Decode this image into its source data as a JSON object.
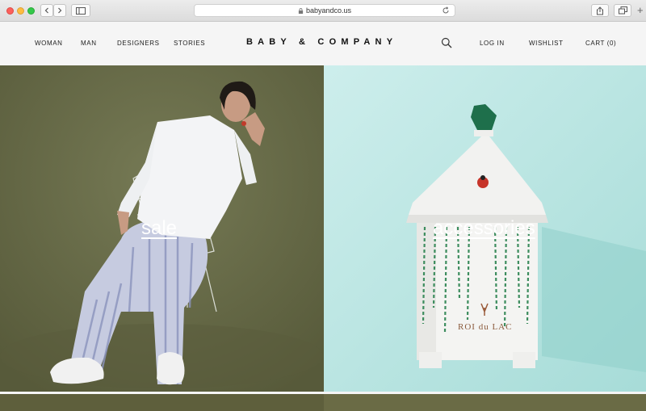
{
  "browser": {
    "url": "babyandco.us"
  },
  "header": {
    "nav_left": [
      "WOMAN",
      "MAN",
      "DESIGNERS",
      "STORIES"
    ],
    "logo": "BABY & COMPANY",
    "log_in": "LOG IN",
    "wishlist": "WISHLIST",
    "cart": "CART (0)"
  },
  "hero": {
    "left_label": "sale",
    "right_label": "accessories",
    "jar_brand": "ROI du LAC"
  },
  "colors": {
    "left_bg": "#6b6f4c",
    "right_bg": "#bfe8e6",
    "header_bg": "#f5f5f5"
  }
}
